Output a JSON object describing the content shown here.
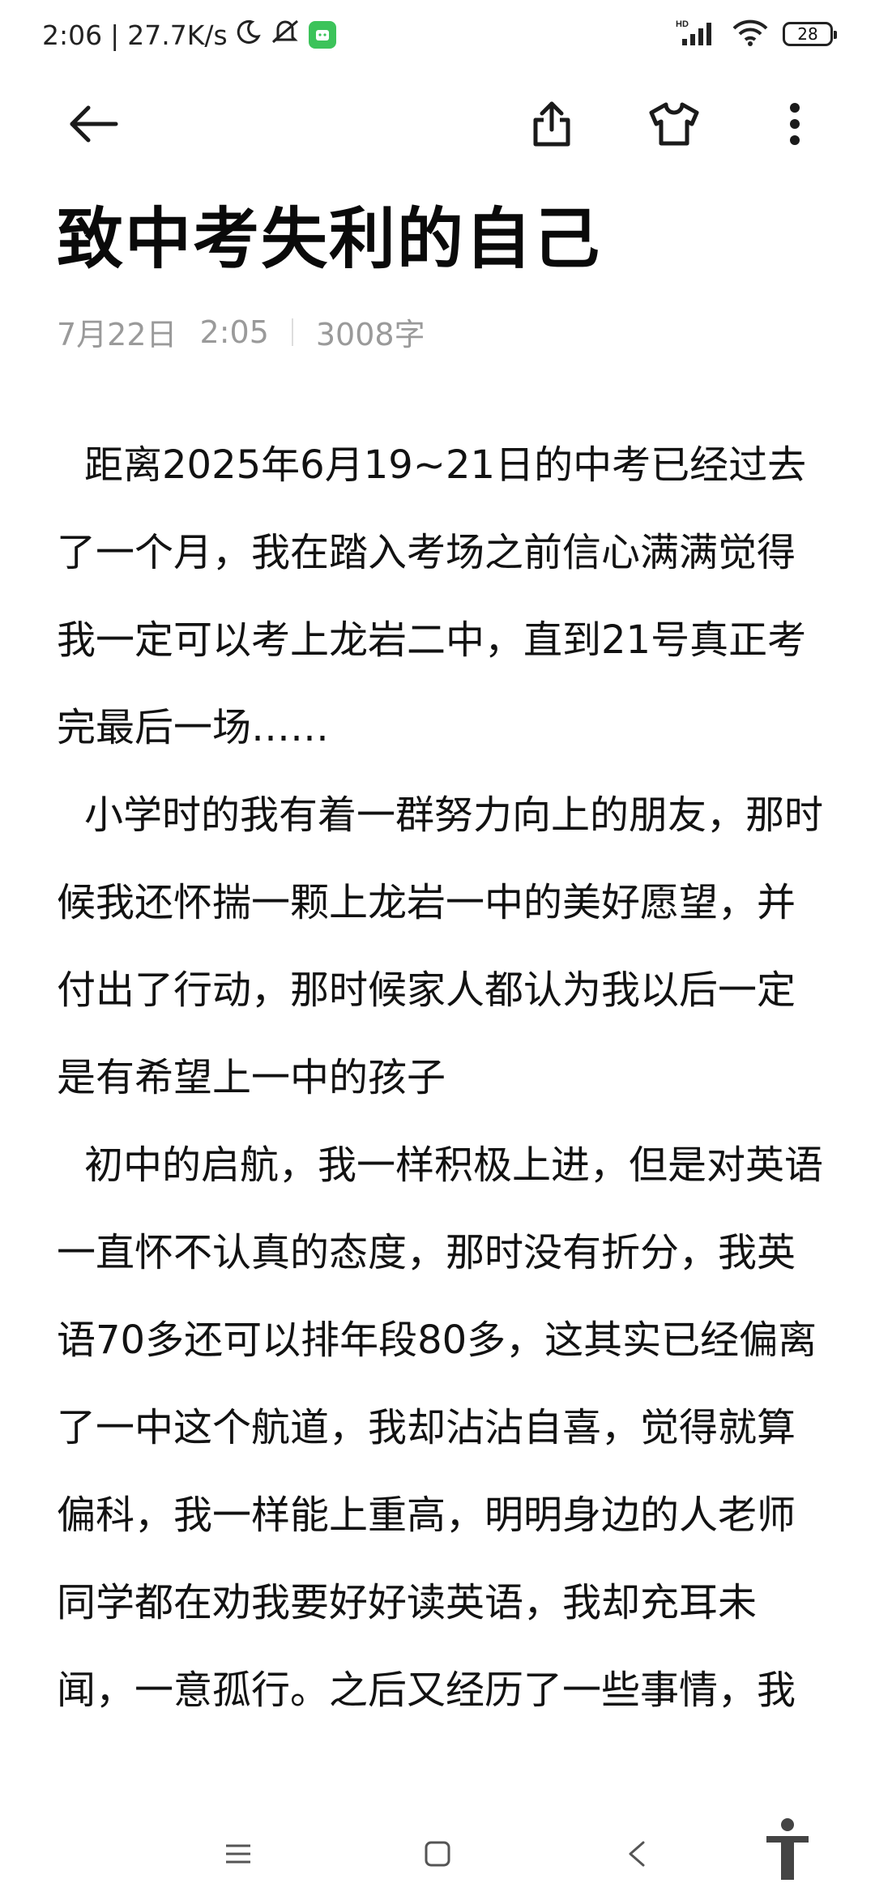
{
  "status_bar": {
    "time": "2:06",
    "speed": "27.7K/s",
    "network": "HD",
    "battery": "28",
    "icons": [
      "moon-icon",
      "mute-icon",
      "app-badge-icon",
      "signal-icon",
      "wifi-icon",
      "battery-icon"
    ]
  },
  "toolbar": {
    "icons": [
      "back-arrow-icon",
      "share-icon",
      "shirt-icon",
      "more-icon"
    ]
  },
  "article": {
    "title": "致中考失利的自己",
    "date": "7月22日",
    "time": "2:05",
    "word_count": "3008字",
    "paragraphs": [
      "距离2025年6月19~21日的中考已经过去了一个月，我在踏入考场之前信心满满觉得我一定可以考上龙岩二中，直到21号真正考完最后一场……",
      "小学时的我有着一群努力向上的朋友，那时候我还怀揣一颗上龙岩一中的美好愿望，并付出了行动，那时候家人都认为我以后一定是有希望上一中的孩子",
      "初中的启航，我一样积极上进，但是对英语一直怀不认真的态度，那时没有折分，我英语70多还可以排年段80多，这其实已经偏离了一中这个航道，我却沾沾自喜，觉得就算偏科，我一样能上重高，明明身边的人老师同学都在劝我要好好读英语，我却充耳未闻，一意孤行。之后又经历了一些事情，我"
    ]
  },
  "nav_bar": {
    "icons": [
      "menu-icon",
      "home-icon",
      "back-icon",
      "accessibility-icon"
    ]
  }
}
